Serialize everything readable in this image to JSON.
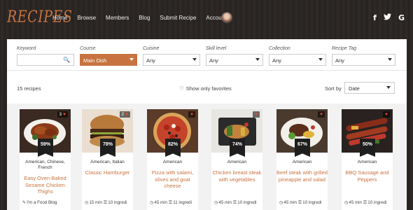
{
  "header": {
    "logo": "RECIPES",
    "nav": [
      "Home",
      "Browse",
      "Members",
      "Blog",
      "Submit Recipe",
      "Account"
    ],
    "social": [
      "f",
      "🐦",
      "G"
    ]
  },
  "filters": {
    "keyword_label": "Keyword",
    "keyword_value": "",
    "course_label": "Course",
    "course_value": "Main Dish",
    "cuisine_label": "Cuisine",
    "cuisine_value": "Any",
    "skill_label": "Skill level",
    "skill_value": "Any",
    "collection_label": "Collection",
    "collection_value": "Any",
    "tag_label": "Recipe Tag",
    "tag_value": "Any"
  },
  "toolbar": {
    "count": "15 recipes",
    "favorites": "Show only favorites",
    "sort_label": "Sort by",
    "sort_value": "Date"
  },
  "cards": [
    {
      "likes": "3",
      "rating": "59%",
      "cuisine": "American, Chinese, French",
      "title": "Easy Oven-Baked Sesame Chicken Thighs",
      "meta": "I'm a Food Blog"
    },
    {
      "likes": "2",
      "rating": "78%",
      "cuisine": "American, Italian",
      "title": "Classic Hamburger",
      "meta_time": "15 min",
      "meta_ing": "10 ingredi"
    },
    {
      "likes": "",
      "rating": "82%",
      "cuisine": "American",
      "title": "Pizza with salami, olives and goat cheese",
      "meta_time": "45 min",
      "meta_ing": "11 ingredi"
    },
    {
      "likes": "",
      "rating": "74%",
      "cuisine": "American",
      "title": "Chicken breast steak with vegetables",
      "meta_time": "45 min",
      "meta_ing": "10 ingredi"
    },
    {
      "likes": "",
      "rating": "67%",
      "cuisine": "American",
      "title": "Beef steak with grilled pineapple and salad",
      "meta_time": "45 min",
      "meta_ing": "10 ingredi"
    },
    {
      "likes": "",
      "rating": "50%",
      "cuisine": "American",
      "title": "BBQ Sausage and Peppers",
      "meta_time": "45 min",
      "meta_ing": "10 ingredi"
    }
  ]
}
